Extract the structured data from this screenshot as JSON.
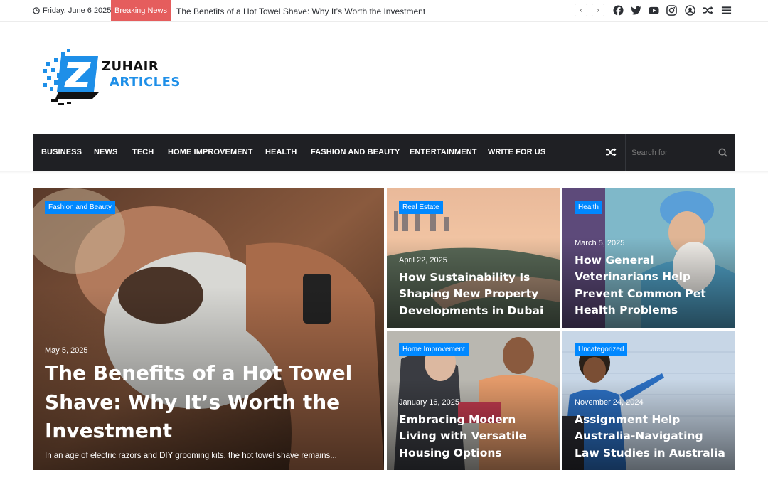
{
  "topbar": {
    "date": "Friday, June 6 2025",
    "breaking_label": "Breaking News",
    "breaking_headline": "The Benefits of a Hot Towel Shave: Why It’s Worth the Investment",
    "icons": [
      "clock-icon",
      "prev-arrow",
      "next-arrow",
      "facebook-icon",
      "twitter-icon",
      "youtube-icon",
      "instagram-icon",
      "user-icon",
      "random-icon",
      "menu-icon"
    ],
    "prev": "‹",
    "next": "›"
  },
  "logo": {
    "line1": "ZUHAIR",
    "line2": "ARTICLES",
    "brand_color": "#1e8fe8"
  },
  "nav": {
    "items": [
      "BUSINESS",
      "NEWS",
      "TECH",
      "HOME IMPROVEMENT",
      "HEALTH",
      "FASHION AND BEAUTY",
      "ENTERTAINMENT",
      "WRITE FOR US"
    ],
    "search_placeholder": "Search for",
    "bg_color": "#1f2024"
  },
  "posts": [
    {
      "category": "Fashion and Beauty",
      "date": "May 5, 2025",
      "title": "The Benefits of a Hot Towel Shave: Why It’s Worth the Investment",
      "excerpt": "In an age of electric razors and DIY grooming kits, the hot towel shave remains..."
    },
    {
      "category": "Real Estate",
      "date": "April 22, 2025",
      "title": "How Sustainability Is Shaping New Property Developments in Dubai"
    },
    {
      "category": "Health",
      "date": "March 5, 2025",
      "title": "How General Veterinarians Help Prevent Common Pet Health Problems"
    },
    {
      "category": "Home Improvement",
      "date": "January 16, 2025",
      "title": "Embracing Modern Living with Versatile Housing Options"
    },
    {
      "category": "Uncategorized",
      "date": "November 24, 2024",
      "title": "Assignment Help Australia-Navigating Law Studies in Australia"
    }
  ],
  "colors": {
    "accent": "#0088ff",
    "breaking": "#e55d5d"
  }
}
